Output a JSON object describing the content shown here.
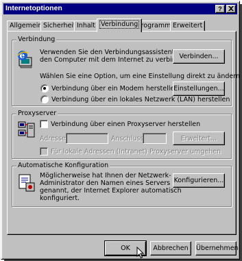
{
  "window": {
    "title": "Internetoptionen",
    "help_button": "?",
    "close_button": "×"
  },
  "tabs": [
    {
      "label": "Allgemein"
    },
    {
      "label": "Sicherheit"
    },
    {
      "label": "Inhalt"
    },
    {
      "label": "Verbindung",
      "active": true
    },
    {
      "label": "Programme"
    },
    {
      "label": "Erweitert"
    }
  ],
  "verbindung": {
    "legend": "Verbindung",
    "wizard_text_1": "Verwenden Sie den Verbindungsassistenten, um",
    "wizard_text_2": "den Computer mit dem Internet zu verbinden.",
    "wizard_button": "Verbinden...",
    "choose_text": "Wählen Sie eine Option, um eine Einstellung direkt zu ändern",
    "radio_modem": "Verbindung über ein Modem herstellen",
    "radio_modem_checked": true,
    "settings_button": "Einstellungen...",
    "radio_lan": "Verbindung über ein lokales Netzwerk (LAN) herstellen"
  },
  "proxy": {
    "legend": "Proxyserver",
    "checkbox_label": "Verbindung über einen Proxyserver herstellen",
    "address_label": "Adresse:",
    "port_label": "Anschluss:",
    "advanced_button": "Erweitert...",
    "bypass_label": "Für lokale Adressen (Intranet) Proxyserver umgehen"
  },
  "autoconfig": {
    "legend": "Automatische Konfiguration",
    "text_1": "Möglicherweise hat Ihnen der Netzwerk-",
    "text_2": "Administrator den Namen eines Servers",
    "text_3": "genannt, der Internet Explorer automatisch",
    "text_4": "konfiguriert.",
    "configure_button": "Konfigurieren..."
  },
  "footer": {
    "ok": "OK",
    "cancel": "Abbrechen",
    "apply": "Übernehmen"
  },
  "colors": {
    "titlebar": "#000080",
    "face": "#c0c0c0"
  }
}
